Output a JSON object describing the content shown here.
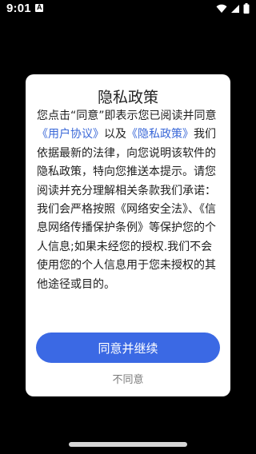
{
  "status_bar": {
    "time": "9:01",
    "notification_letter": "A",
    "icons": [
      "notification-icon",
      "wifi-icon",
      "signal-icon",
      "battery-icon"
    ]
  },
  "dialog": {
    "title": "隐私政策",
    "body": {
      "part1": "您点击“同意”即表示您已阅读并同意",
      "user_agreement_link": "《用户协议》",
      "part2": "以及",
      "privacy_policy_link": "《隐私政策》",
      "part3": "我们依据最新的法律，向您说明该软件的隐私政策，特向您推送本提示。请您阅读并充分理解相关条款我们承诺：",
      "part4": "我们会严格按照《网络安全法》、《信息网络传播保护条例》等保护您的个人信息;如果未经您的授权.我们不会使用您的个人信息用于您未授权的其他途径或目的。"
    },
    "agree_label": "同意并继续",
    "disagree_label": "不同意"
  },
  "colors": {
    "accent": "#3b69e4",
    "link": "#3a68d8",
    "background": "#000000",
    "dialog": "#ffffff"
  }
}
